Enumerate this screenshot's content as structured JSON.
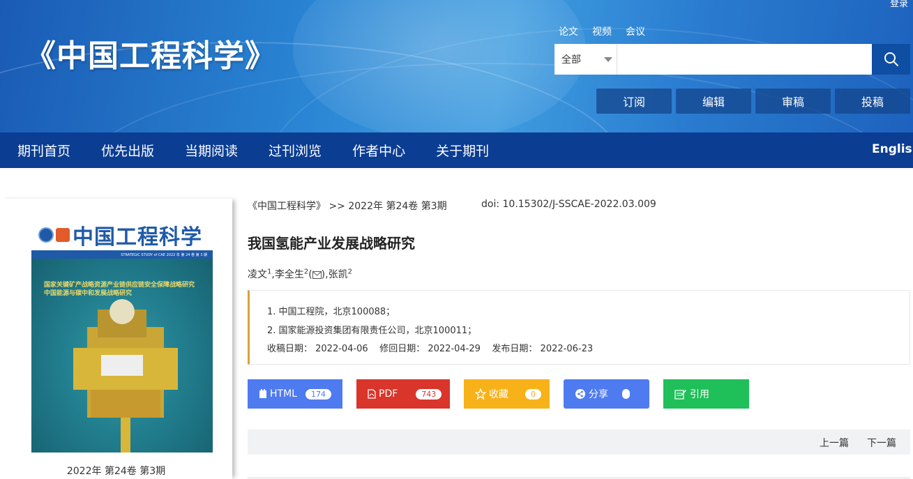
{
  "header": {
    "site_title": "《中国工程科学》",
    "login": "登录",
    "search_tabs": [
      "论文",
      "视频",
      "会议"
    ],
    "search_scope": "全部",
    "search_placeholder": "",
    "actions": [
      "订阅",
      "编辑",
      "审稿",
      "投稿"
    ]
  },
  "nav": {
    "items": [
      "期刊首页",
      "优先出版",
      "当期阅读",
      "过刊浏览",
      "作者中心",
      "关于期刊"
    ],
    "english": "English"
  },
  "cover": {
    "journal_name": "中国工程科学",
    "strip_text": "STRATEGIC STUDY of CAE   2022 年 第 24 卷 第 3 期",
    "caption_lines": [
      "国家关键矿产战略资源产业链供应链安全保障战略研究",
      "中国能源与碳中和发展战略研究"
    ],
    "issue": "2022年 第24卷 第3期"
  },
  "article": {
    "breadcrumb": "《中国工程科学》 >> 2022年 第24卷 第3期",
    "doi": "doi: 10.15302/J-SSCAE-2022.03.009",
    "title": "我国氢能产业发展战略研究",
    "authors": [
      {
        "name": "凌文",
        "sup": "1"
      },
      {
        "name": ",李全生",
        "sup": "2"
      },
      {
        "name": ",张凯",
        "sup": "2"
      }
    ],
    "affiliations": [
      "1. 中国工程院，北京100088；",
      "2. 国家能源投资集团有限责任公司，北京100011；"
    ],
    "dates": "收稿日期： 2022-04-06    修回日期： 2022-04-29    发布日期： 2022-06-23"
  },
  "buttons": {
    "html": {
      "label": "HTML",
      "count": "174",
      "color": "#4f7bf0"
    },
    "pdf": {
      "label": "PDF",
      "count": "743",
      "color": "#d9352b"
    },
    "fav": {
      "label": "收藏",
      "count": "0",
      "color": "#f7b21a"
    },
    "share": {
      "label": "分享",
      "color": "#4f7bf0"
    },
    "cite": {
      "label": "引用",
      "color": "#1fbf5a"
    }
  },
  "pager": {
    "prev": "上一篇",
    "next": "下一篇"
  }
}
